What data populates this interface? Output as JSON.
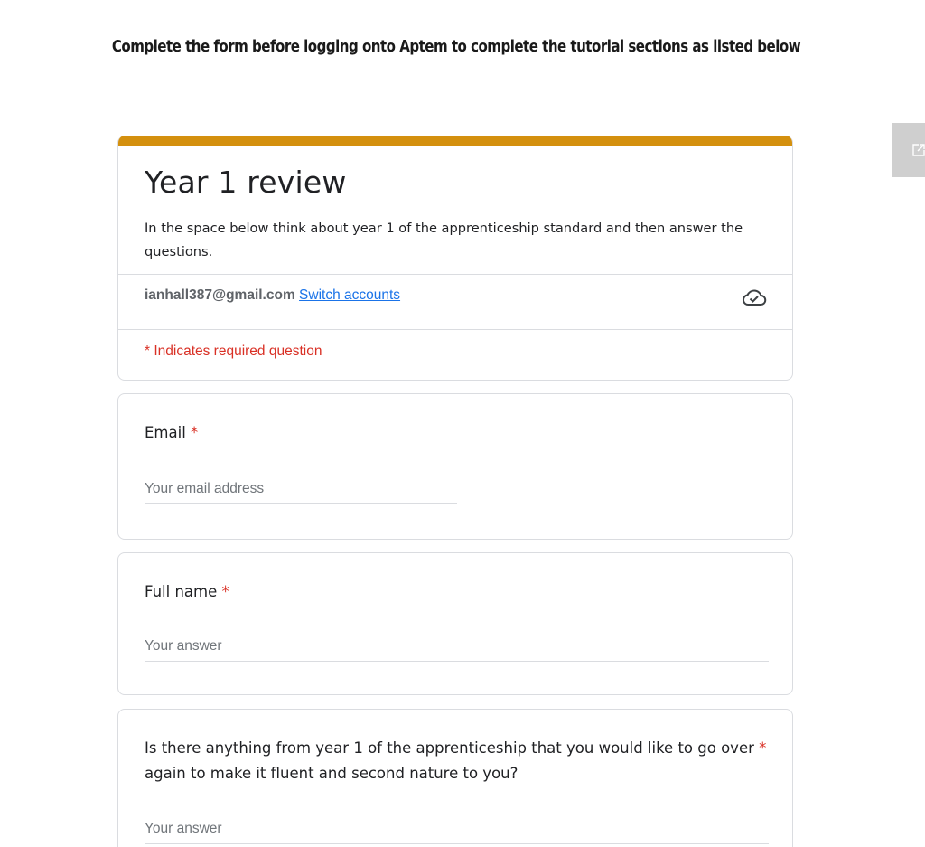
{
  "page": {
    "heading": "Complete the form before logging onto Aptem to complete the tutorial sections as listed below"
  },
  "popout": {
    "icon": "open-in-new-icon"
  },
  "form": {
    "accent_color": "#d4900e",
    "title": "Year 1 review",
    "description": "In the space below think about year 1 of the apprenticeship standard and then answer the questions.",
    "account": {
      "email": "ianhall387@gmail.com",
      "switch_label": "Switch accounts",
      "cloud_icon": "cloud-done-icon"
    },
    "required_note": "* Indicates required question",
    "required_color": "#d93025",
    "link_color": "#1a73e8"
  },
  "questions": [
    {
      "label": "Email",
      "required_mark": "*",
      "placeholder": "Your email address",
      "value": ""
    },
    {
      "label": "Full name",
      "required_mark": "*",
      "placeholder": "Your answer",
      "value": ""
    },
    {
      "label": "Is there anything from year 1 of the apprenticeship that you would like to go over",
      "label_line2": "again to make it fluent and second nature to you?",
      "required_mark": "*",
      "placeholder": "Your answer",
      "value": ""
    }
  ]
}
